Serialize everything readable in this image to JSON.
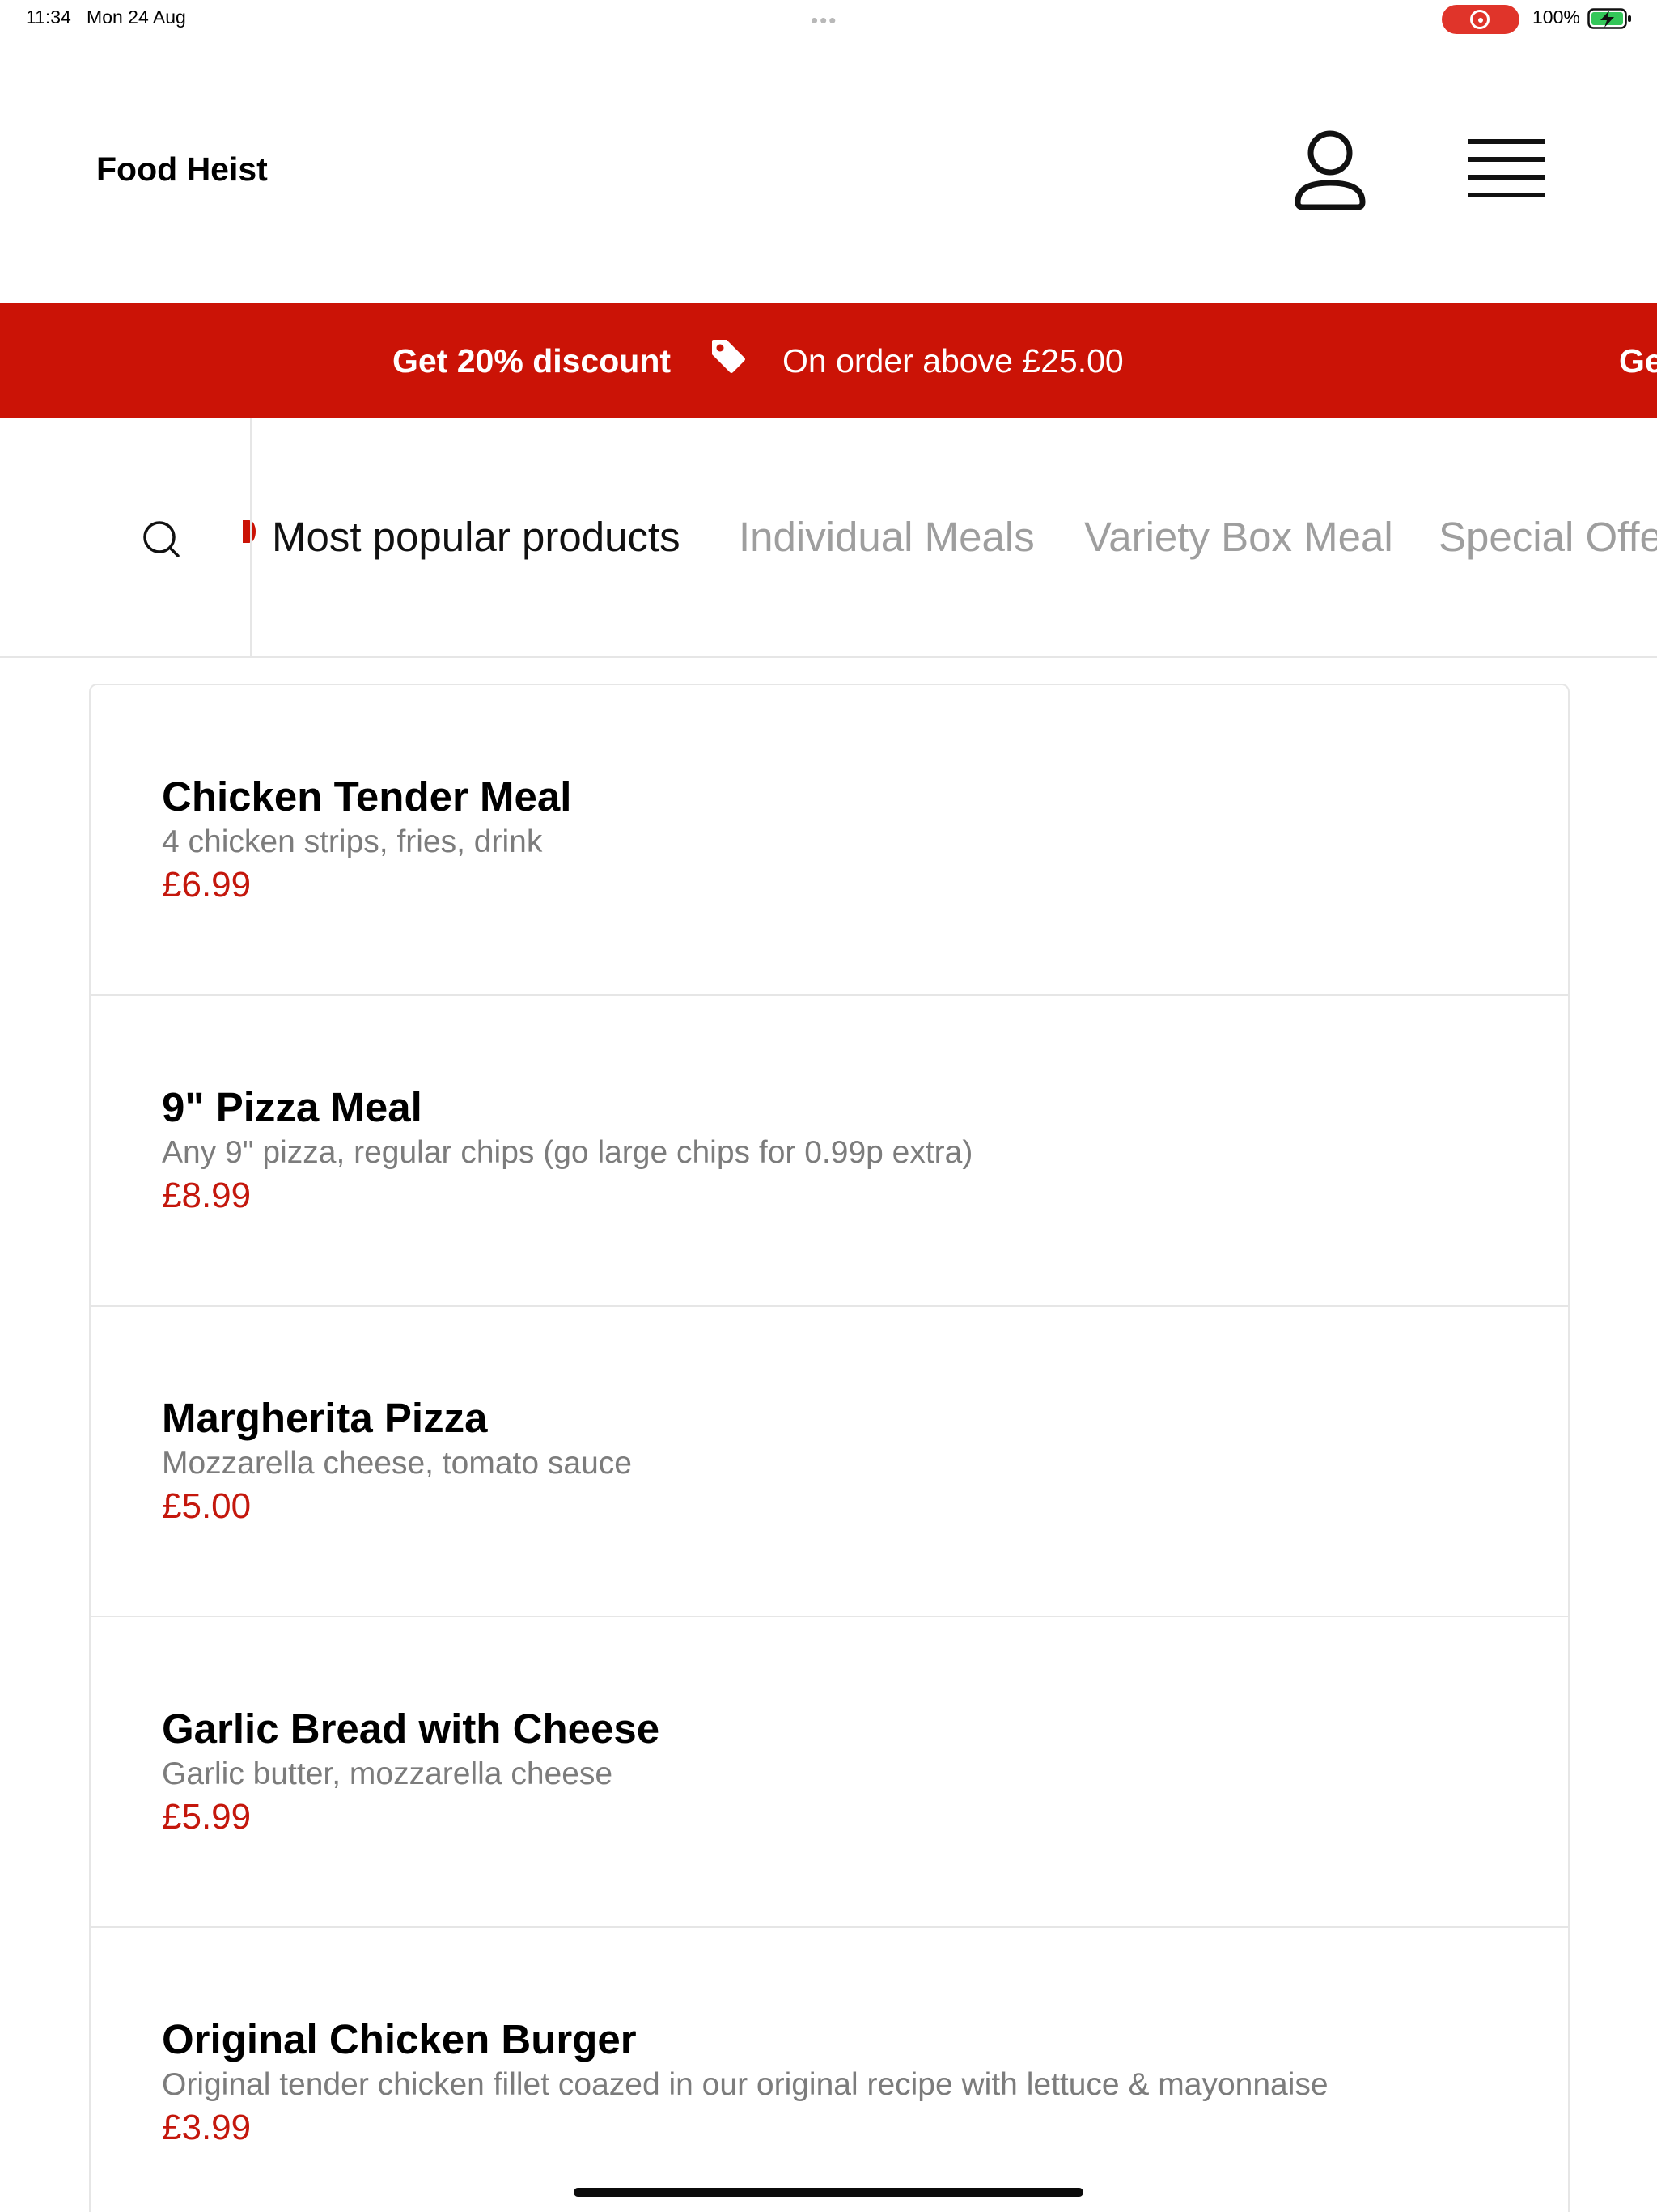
{
  "status_bar": {
    "time": "11:34",
    "date": "Mon 24 Aug",
    "dots": "•••",
    "battery": "100%",
    "recording_color": "#e0342a",
    "battery_color": "#34c759"
  },
  "header": {
    "brand": "Food Heist",
    "account_icon": "person-outline-icon",
    "menu_icon": "hamburger-menu-icon"
  },
  "promo": {
    "bold_text": "Get 20% discount",
    "text": "On order above £25.00",
    "repeat_bold_text": "Ge",
    "tag_icon": "price-tag-icon",
    "background": "#cb1306"
  },
  "categories": {
    "search_icon": "search-icon",
    "items": [
      {
        "label": "Most popular products",
        "active": true
      },
      {
        "label": "Individual Meals",
        "active": false
      },
      {
        "label": "Variety Box Meal",
        "active": false
      },
      {
        "label": "Special Offe",
        "active": false
      }
    ]
  },
  "products": [
    {
      "name": "Chicken Tender Meal",
      "description": "4 chicken strips, fries, drink",
      "price": "£6.99"
    },
    {
      "name": "9\" Pizza Meal",
      "description": "Any 9\" pizza, regular chips (go large chips for 0.99p extra)",
      "price": "£8.99"
    },
    {
      "name": "Margherita Pizza",
      "description": "Mozzarella cheese, tomato sauce",
      "price": "£5.00"
    },
    {
      "name": "Garlic Bread with Cheese",
      "description": "Garlic butter, mozzarella cheese",
      "price": "£5.99"
    },
    {
      "name": "Original Chicken Burger",
      "description": "Original tender chicken fillet coazed in our original recipe with lettuce & mayonnaise",
      "price": "£3.99"
    }
  ],
  "colors": {
    "accent": "#cb1306",
    "price": "#c4170c",
    "muted": "#9e9e9e"
  }
}
